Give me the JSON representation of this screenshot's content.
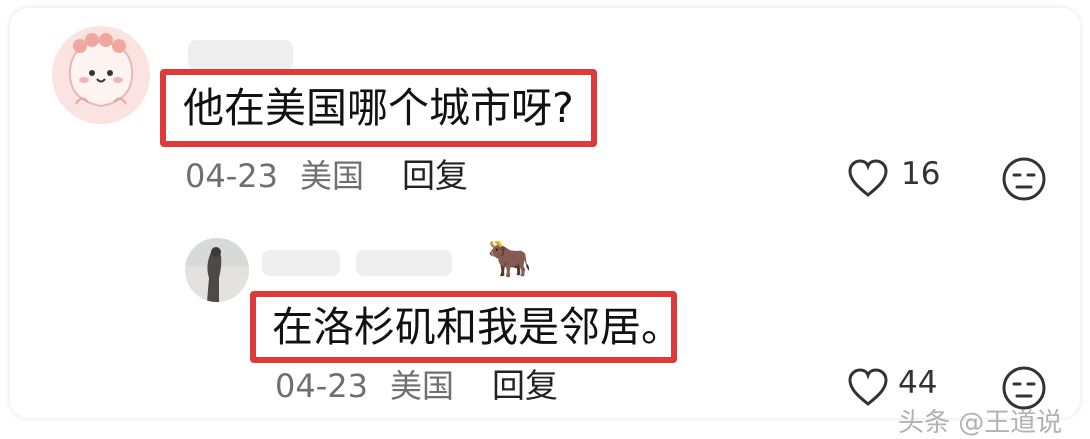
{
  "colors": {
    "highlight": "#de3a3a",
    "meta_text": "#6f6f6f",
    "body_text": "#111111"
  },
  "comments": [
    {
      "text": "他在美国哪个城市呀?",
      "date": "04-23",
      "location": "美国",
      "reply_label": "回复",
      "likes": "16",
      "avatar_icon": "cartoon-avatar-icon"
    }
  ],
  "replies": [
    {
      "text": "在洛杉矶和我是邻居。",
      "date": "04-23",
      "location": "美国",
      "reply_label": "回复",
      "likes": "44",
      "badge": "🐂",
      "avatar_icon": "photo-avatar-icon"
    }
  ],
  "watermark": "头条 @王道说"
}
